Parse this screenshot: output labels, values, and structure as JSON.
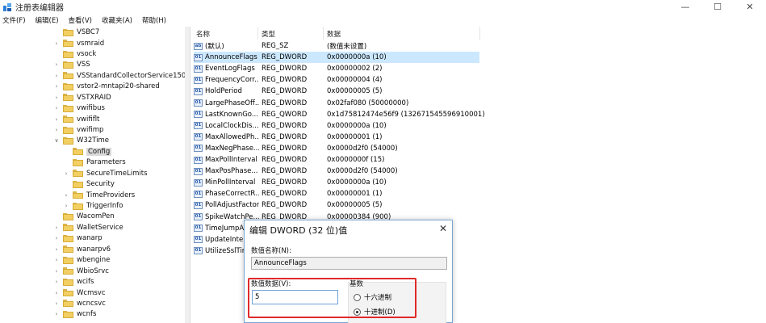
{
  "window": {
    "title": "注册表编辑器",
    "controls": {
      "minimize": "—",
      "maximize": "☐",
      "close": "✕"
    }
  },
  "menu": [
    "文件(F)",
    "编辑(E)",
    "查看(V)",
    "收藏夹(A)",
    "帮助(H)"
  ],
  "tree": {
    "items": [
      {
        "label": "VSBC7",
        "expand": "",
        "level": 0
      },
      {
        "label": "vsmraid",
        "expand": ">",
        "level": 0
      },
      {
        "label": "vsock",
        "expand": "",
        "level": 0
      },
      {
        "label": "VSS",
        "expand": ">",
        "level": 0
      },
      {
        "label": "VSStandardCollectorService150",
        "expand": ">",
        "level": 0
      },
      {
        "label": "vstor2-mntapi20-shared",
        "expand": ">",
        "level": 0
      },
      {
        "label": "VSTXRAID",
        "expand": ">",
        "level": 0
      },
      {
        "label": "vwifibus",
        "expand": ">",
        "level": 0
      },
      {
        "label": "vwififlt",
        "expand": ">",
        "level": 0
      },
      {
        "label": "vwifimp",
        "expand": ">",
        "level": 0
      },
      {
        "label": "W32Time",
        "expand": "v",
        "level": 0
      },
      {
        "label": "Config",
        "expand": "",
        "level": 1,
        "selected": true
      },
      {
        "label": "Parameters",
        "expand": "",
        "level": 1
      },
      {
        "label": "SecureTimeLimits",
        "expand": ">",
        "level": 1
      },
      {
        "label": "Security",
        "expand": "",
        "level": 1
      },
      {
        "label": "TimeProviders",
        "expand": ">",
        "level": 1
      },
      {
        "label": "TriggerInfo",
        "expand": ">",
        "level": 1
      },
      {
        "label": "WacomPen",
        "expand": "",
        "level": 0
      },
      {
        "label": "WalletService",
        "expand": ">",
        "level": 0
      },
      {
        "label": "wanarp",
        "expand": ">",
        "level": 0
      },
      {
        "label": "wanarpv6",
        "expand": ">",
        "level": 0
      },
      {
        "label": "wbengine",
        "expand": ">",
        "level": 0
      },
      {
        "label": "WbioSrvc",
        "expand": ">",
        "level": 0
      },
      {
        "label": "wcifs",
        "expand": ">",
        "level": 0
      },
      {
        "label": "Wcmsvc",
        "expand": ">",
        "level": 0
      },
      {
        "label": "wcncsvc",
        "expand": ">",
        "level": 0
      },
      {
        "label": "wcnfs",
        "expand": ">",
        "level": 0
      }
    ]
  },
  "columns": {
    "name": "名称",
    "type": "类型",
    "data": "数据"
  },
  "values": [
    {
      "icon": "ab",
      "name": "(默认)",
      "type": "REG_SZ",
      "data": "(数值未设置)"
    },
    {
      "icon": "01",
      "name": "AnnounceFlags",
      "type": "REG_DWORD",
      "data": "0x0000000a (10)",
      "selected": true
    },
    {
      "icon": "01",
      "name": "EventLogFlags",
      "type": "REG_DWORD",
      "data": "0x00000002 (2)"
    },
    {
      "icon": "01",
      "name": "FrequencyCorr...",
      "type": "REG_DWORD",
      "data": "0x00000004 (4)"
    },
    {
      "icon": "01",
      "name": "HoldPeriod",
      "type": "REG_DWORD",
      "data": "0x00000005 (5)"
    },
    {
      "icon": "01",
      "name": "LargePhaseOff...",
      "type": "REG_DWORD",
      "data": "0x02faf080 (50000000)"
    },
    {
      "icon": "01",
      "name": "LastKnownGo...",
      "type": "REG_QWORD",
      "data": "0x1d75812474e56f9 (132671545596910001)"
    },
    {
      "icon": "01",
      "name": "LocalClockDis...",
      "type": "REG_DWORD",
      "data": "0x0000000a (10)"
    },
    {
      "icon": "01",
      "name": "MaxAllowedPh...",
      "type": "REG_DWORD",
      "data": "0x00000001 (1)"
    },
    {
      "icon": "01",
      "name": "MaxNegPhase...",
      "type": "REG_DWORD",
      "data": "0x0000d2f0 (54000)"
    },
    {
      "icon": "01",
      "name": "MaxPollInterval",
      "type": "REG_DWORD",
      "data": "0x0000000f (15)"
    },
    {
      "icon": "01",
      "name": "MaxPosPhase...",
      "type": "REG_DWORD",
      "data": "0x0000d2f0 (54000)"
    },
    {
      "icon": "01",
      "name": "MinPollInterval",
      "type": "REG_DWORD",
      "data": "0x0000000a (10)"
    },
    {
      "icon": "01",
      "name": "PhaseCorrectR...",
      "type": "REG_DWORD",
      "data": "0x00000001 (1)"
    },
    {
      "icon": "01",
      "name": "PollAdjustFactor",
      "type": "REG_DWORD",
      "data": "0x00000005 (5)"
    },
    {
      "icon": "01",
      "name": "SpikeWatchPe...",
      "type": "REG_DWORD",
      "data": "0x00000384 (900)"
    },
    {
      "icon": "01",
      "name": "TimeJumpAu...",
      "type": "",
      "data": ""
    },
    {
      "icon": "01",
      "name": "UpdateInterv...",
      "type": "",
      "data": ""
    },
    {
      "icon": "01",
      "name": "UtilizeSslTim...",
      "type": "",
      "data": ""
    }
  ],
  "dialog": {
    "title": "编辑 DWORD (32 位)值",
    "close": "✕",
    "name_label": "数值名称(N):",
    "name_value": "AnnounceFlags",
    "data_label": "数值数据(V):",
    "data_value": "5",
    "base_label": "基数",
    "radio_hex": "十六进制",
    "radio_dec": "十进制(D)",
    "selected_base": "decimal"
  },
  "colors": {
    "selection": "#cce8ff",
    "tree_selection": "#d9d9d9",
    "highlight_box": "#e02a2a",
    "folder": "#f2cf63"
  }
}
